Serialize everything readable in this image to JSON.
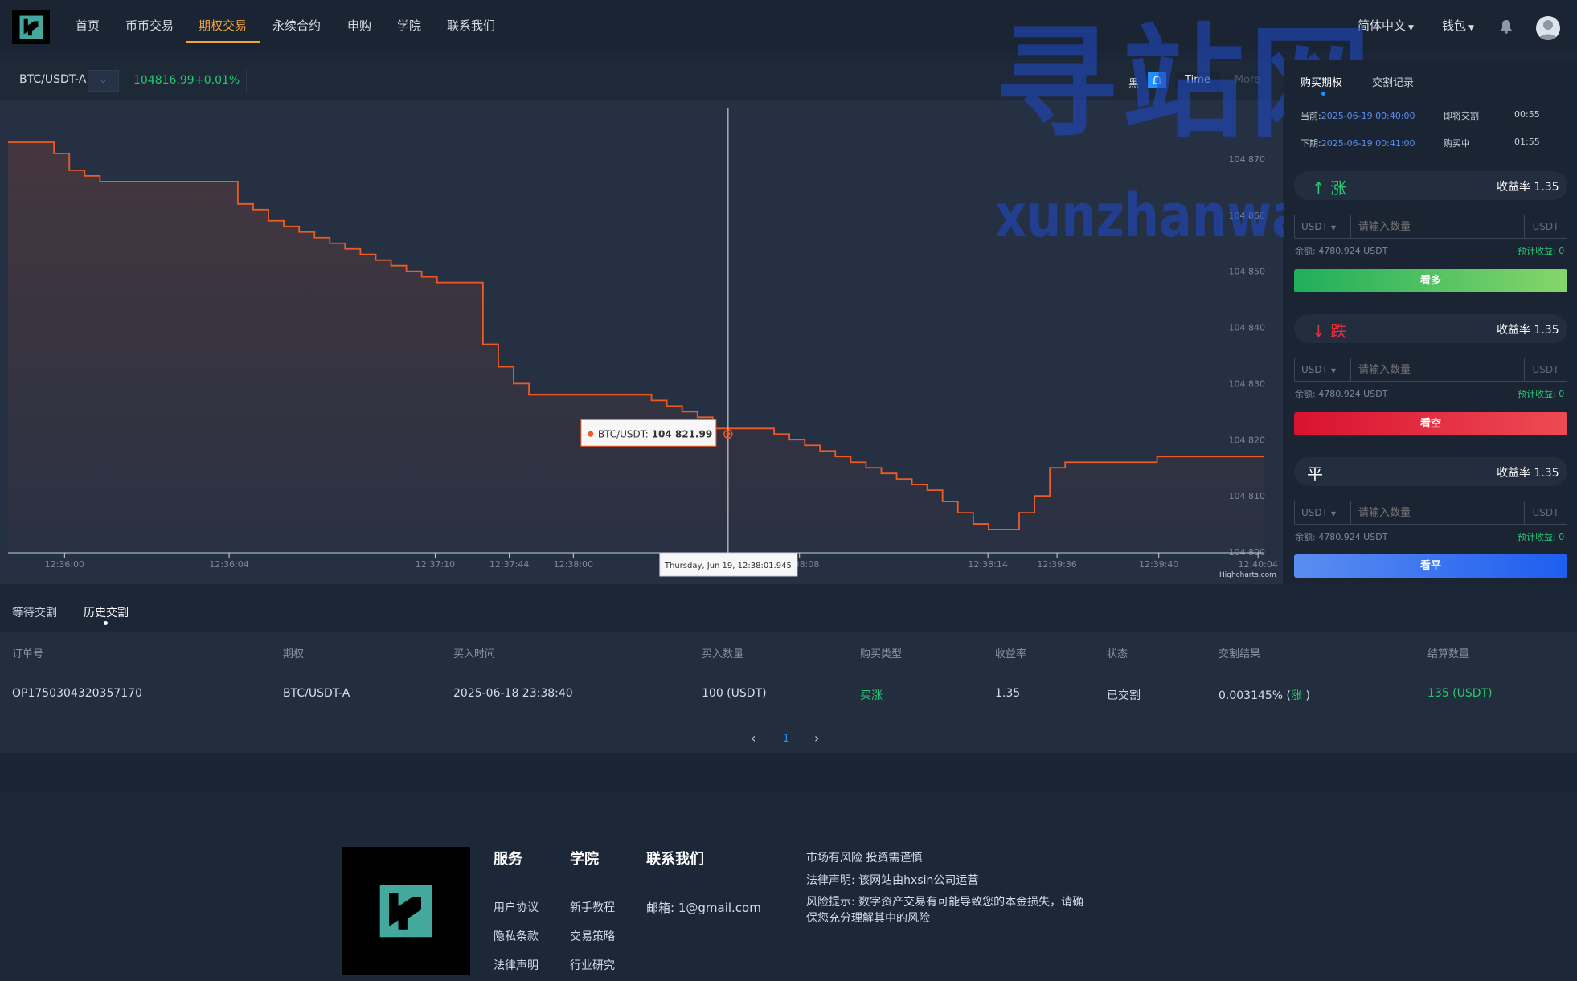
{
  "nav": {
    "items": [
      "首页",
      "币币交易",
      "期权交易",
      "永续合约",
      "申购",
      "学院",
      "联系我们"
    ],
    "active_index": 2,
    "language": "简体中文",
    "wallet": "钱包"
  },
  "pair": {
    "name": "BTC/USDT-A",
    "price": "104816.99",
    "change": "+0.01%"
  },
  "chart_toolbar": {
    "theme": "黑",
    "time": "Time",
    "more": "More"
  },
  "watermark": {
    "cn": "寻站网",
    "en": "xunzhanwang.com"
  },
  "chart_data": {
    "type": "line",
    "series": [
      {
        "name": "BTC/USDT",
        "color": "#ee5a24",
        "values": [
          104873,
          104873,
          104873,
          104871,
          104868,
          104867,
          104866,
          104866,
          104866,
          104866,
          104866,
          104866,
          104866,
          104866,
          104866,
          104862,
          104861,
          104859,
          104858,
          104857,
          104856,
          104855,
          104854,
          104853,
          104852,
          104851,
          104850,
          104849,
          104848,
          104848,
          104848,
          104837,
          104833,
          104830,
          104828,
          104828,
          104828,
          104828,
          104828,
          104828,
          104828,
          104828,
          104827,
          104826,
          104825,
          104824,
          104822,
          104822,
          104822,
          104822,
          104821,
          104820,
          104819,
          104818,
          104817,
          104816,
          104815,
          104814,
          104813,
          104812,
          104811,
          104809,
          104807,
          104805,
          104804,
          104804,
          104807,
          104810,
          104815,
          104816,
          104816,
          104816,
          104816,
          104816,
          104816,
          104817,
          104817,
          104817,
          104817,
          104817,
          104817,
          104817,
          104817
        ]
      }
    ],
    "x_ticks": [
      "12:36:00",
      "12:36:04",
      "12:37:10",
      "12:37:44",
      "12:38:00",
      "12:38:08",
      "12:38:14",
      "12:39:36",
      "12:39:40",
      "12:40:04"
    ],
    "y_ticks": [
      "104 870",
      "104 860",
      "104 850",
      "104 840",
      "104 830",
      "104 820",
      "104 810",
      "104 800"
    ],
    "ylim": [
      104800,
      104875
    ],
    "grid": false,
    "tooltip": {
      "series": "BTC/USDT",
      "value": "104 821.99",
      "time": "Thursday, Jun 19, 12:38:01.945"
    },
    "credit": "Highcharts.com"
  },
  "right": {
    "tabs": [
      "购买期权",
      "交割记录"
    ],
    "current_label": "当前:",
    "current_time": "2025-06-19 00:40:00",
    "current_status": "即将交割",
    "current_countdown": "00:55",
    "next_label": "下期:",
    "next_time": "2025-06-19 00:41:00",
    "next_status": "购买中",
    "next_countdown": "01:55",
    "cards": [
      {
        "symbol": "↑",
        "title": "涨",
        "rate": "收益率 1.35",
        "button": "看多",
        "color": "#28c76f"
      },
      {
        "symbol": "↓",
        "title": "跌",
        "rate": "收益率 1.35",
        "button": "看空",
        "color": "#ea2f3c"
      },
      {
        "symbol": "",
        "title": "平",
        "rate": "收益率 1.35",
        "button": "看平",
        "color": "#4d7cff"
      }
    ],
    "currency": "USDT",
    "placeholder": "请输入数量",
    "unit": "USDT",
    "balance": "余额: 4780.924 USDT",
    "estimate": "预计收益: 0"
  },
  "orders": {
    "tabs": [
      "等待交割",
      "历史交割"
    ],
    "headers": [
      "订单号",
      "期权",
      "买入时间",
      "买入数量",
      "购买类型",
      "收益率",
      "状态",
      "交割结果",
      "结算数量"
    ],
    "rows": [
      {
        "id": "OP1750304320357170",
        "option": "BTC/USDT-A",
        "time": "2025-06-18 23:38:40",
        "amount": "100 (USDT)",
        "type": "买涨",
        "rate": "1.35",
        "status": "已交割",
        "result_pct": "0.003145% (",
        "result_dir": "涨",
        "result_end": " )",
        "settle": "135 (USDT)"
      }
    ],
    "page": "1"
  },
  "footer": {
    "heads": [
      "服务",
      "学院",
      "联系我们"
    ],
    "service_links": [
      "用户协议",
      "隐私条款",
      "法律声明"
    ],
    "academy_links": [
      "新手教程",
      "交易策略",
      "行业研究"
    ],
    "email": "邮箱: 1@gmail.com",
    "risk1": "市场有风险 投资需谨慎",
    "legal": "法律声明: 该网站由hxsin公司运营",
    "risk2": "风险提示: 数字资产交易有可能导致您的本金损失，请确保您充分理解其中的风险"
  }
}
